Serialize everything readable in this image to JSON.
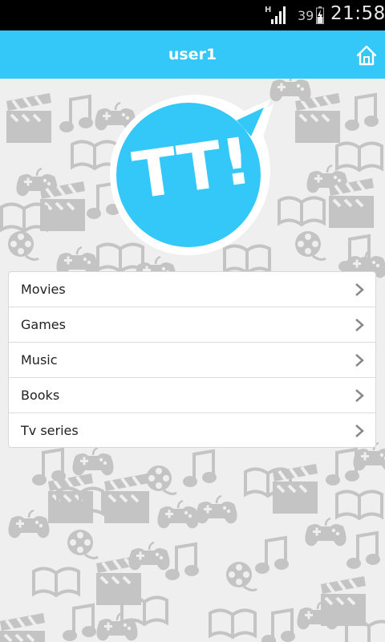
{
  "status_bar": {
    "signal_label": "H",
    "battery_level": "39",
    "time": "21:58"
  },
  "app_bar": {
    "title": "user1",
    "home_icon": "home-icon"
  },
  "logo": {
    "text": "TT!",
    "color": "#33c8f7"
  },
  "menu": {
    "items": [
      {
        "label": "Movies"
      },
      {
        "label": "Games"
      },
      {
        "label": "Music"
      },
      {
        "label": "Books"
      },
      {
        "label": "Tv series"
      }
    ]
  },
  "colors": {
    "accent": "#33c8f7",
    "pattern": "#c4c4c4",
    "background": "#efefef"
  }
}
